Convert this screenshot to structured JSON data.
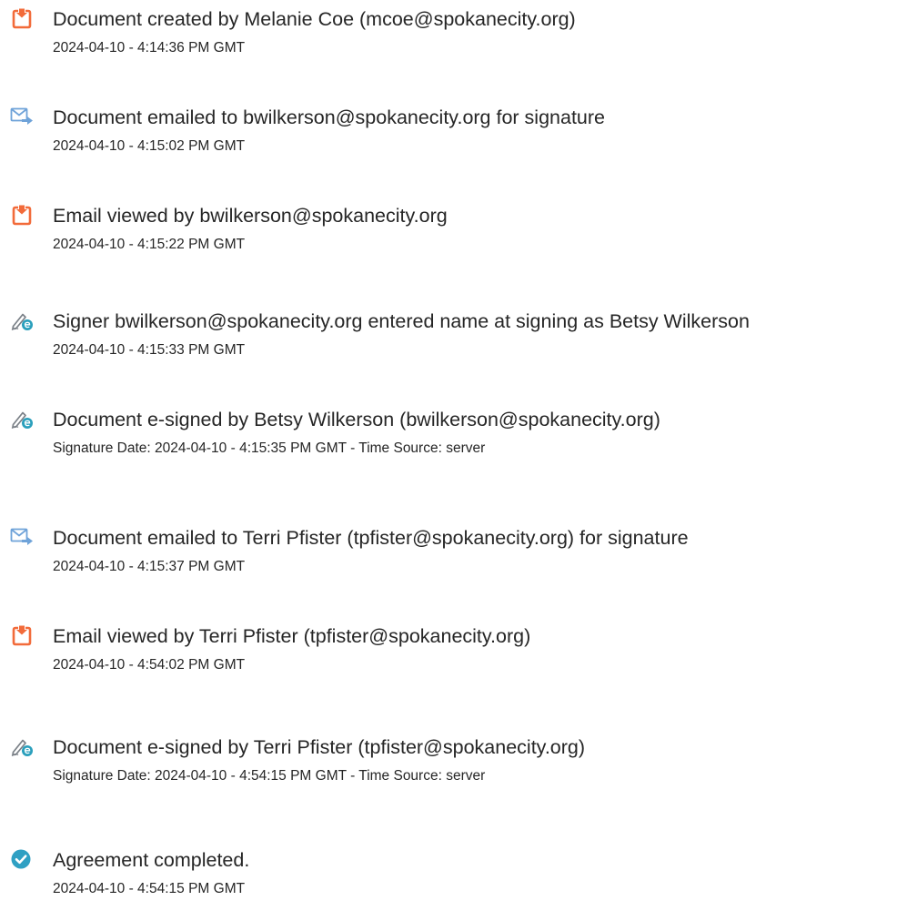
{
  "events": [
    {
      "icon": "document-created-icon",
      "title": "Document created by Melanie Coe (mcoe@spokanecity.org)",
      "subtitle": "2024-04-10 - 4:14:36 PM GMT"
    },
    {
      "icon": "email-sent-icon",
      "title": "Document emailed to bwilkerson@spokanecity.org for signature",
      "subtitle": "2024-04-10 - 4:15:02 PM GMT"
    },
    {
      "icon": "document-viewed-icon",
      "title": "Email viewed by bwilkerson@spokanecity.org",
      "subtitle": "2024-04-10 - 4:15:22 PM GMT"
    },
    {
      "icon": "e-sign-icon",
      "title": "Signer bwilkerson@spokanecity.org entered name at signing as Betsy Wilkerson",
      "subtitle": "2024-04-10 - 4:15:33 PM GMT"
    },
    {
      "icon": "e-sign-icon",
      "title": "Document e-signed by Betsy Wilkerson (bwilkerson@spokanecity.org)",
      "subtitle": "Signature Date: 2024-04-10 - 4:15:35 PM GMT - Time Source: server"
    },
    {
      "icon": "email-sent-icon",
      "title": "Document emailed to Terri Pfister (tpfister@spokanecity.org) for signature",
      "subtitle": "2024-04-10 - 4:15:37 PM GMT"
    },
    {
      "icon": "document-viewed-icon",
      "title": "Email viewed by Terri Pfister (tpfister@spokanecity.org)",
      "subtitle": "2024-04-10 - 4:54:02 PM GMT"
    },
    {
      "icon": "e-sign-icon",
      "title": "Document e-signed by Terri Pfister (tpfister@spokanecity.org)",
      "subtitle": "Signature Date: 2024-04-10 - 4:54:15 PM GMT - Time Source: server"
    },
    {
      "icon": "agreement-completed-icon",
      "title": "Agreement completed.",
      "subtitle": "2024-04-10 - 4:54:15 PM GMT"
    }
  ],
  "colors": {
    "document_icon": "#f26b3a",
    "email_icon": "#6fa3d9",
    "sign_icon_stroke": "#7a8087",
    "sign_badge": "#2a9fbc",
    "completed_icon": "#2fa0c3"
  }
}
